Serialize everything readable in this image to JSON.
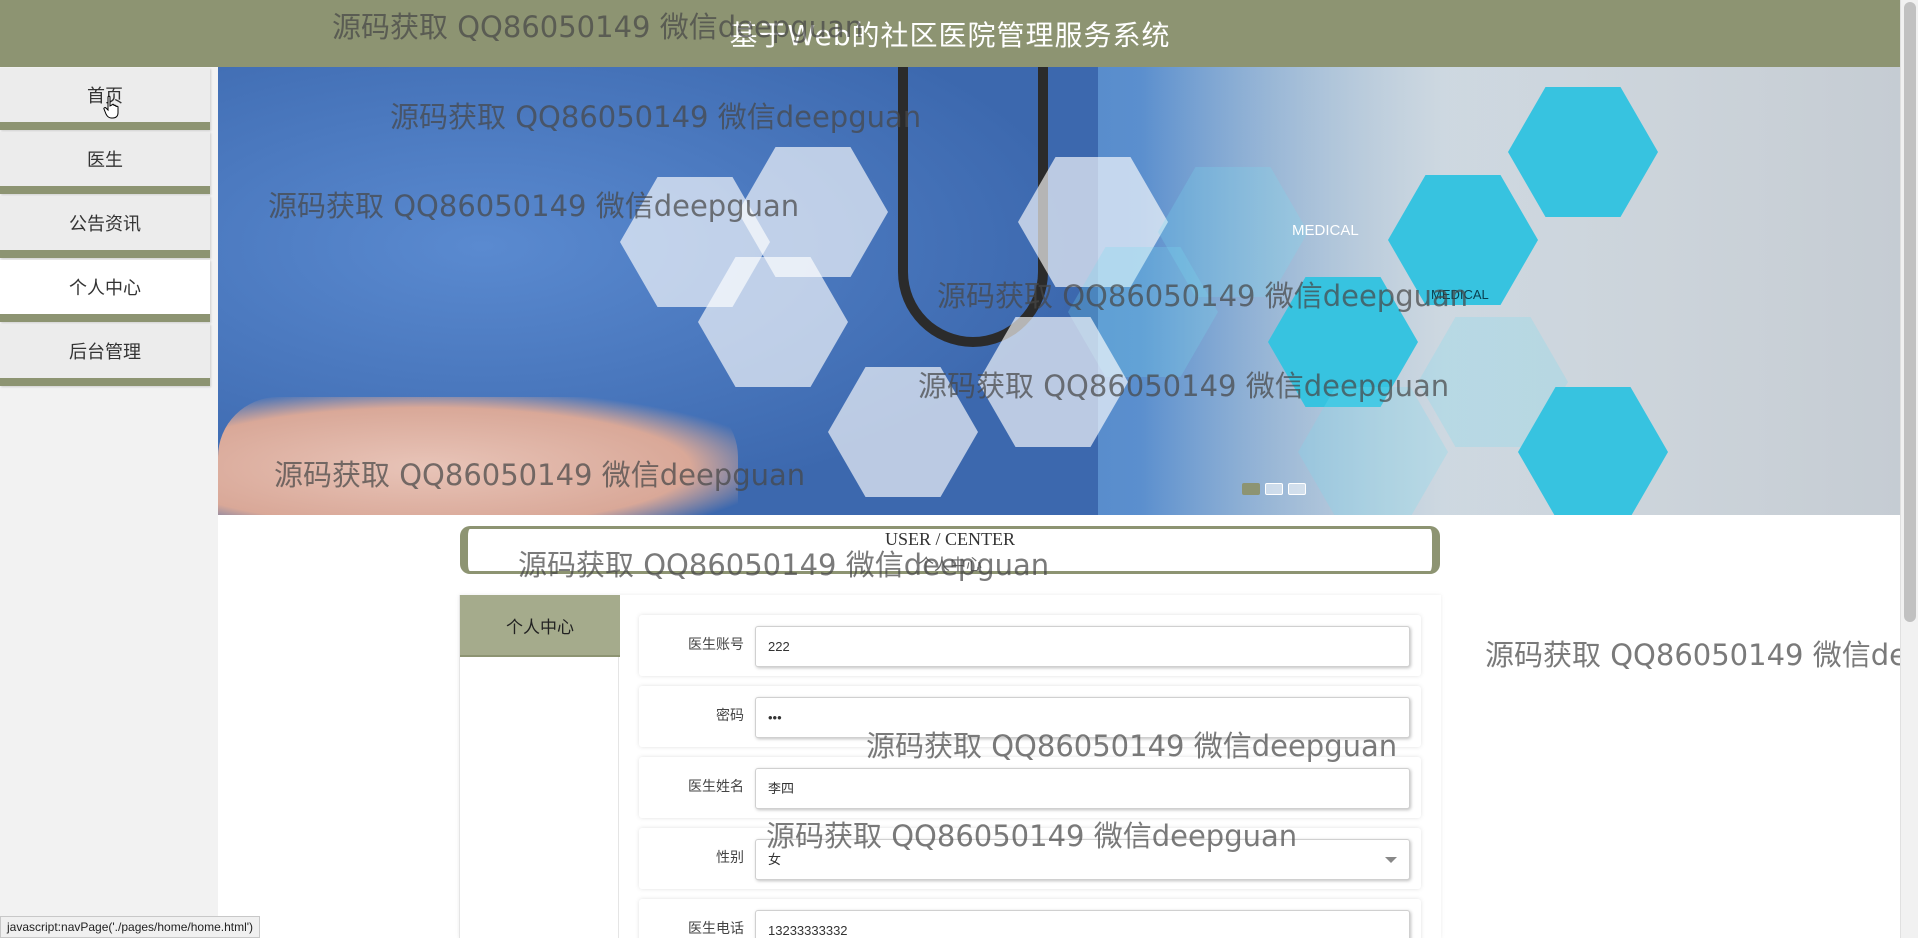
{
  "header": {
    "title": "基于Web的社区医院管理服务系统"
  },
  "sidebar": {
    "items": [
      {
        "label": "首页"
      },
      {
        "label": "医生"
      },
      {
        "label": "公告资讯"
      },
      {
        "label": "个人中心"
      },
      {
        "label": "后台管理"
      }
    ],
    "active_index": 3
  },
  "banner": {
    "hex_labels": [
      "MEDICAL",
      "MEDICAL"
    ],
    "slides": 3,
    "active_slide": 0
  },
  "user_center": {
    "title": "USER / CENTER",
    "subtitle": "个人中心"
  },
  "tabs": [
    {
      "label": "个人中心"
    }
  ],
  "form": {
    "fields": [
      {
        "label": "医生账号",
        "value": "222"
      },
      {
        "label": "密码",
        "value": "•••"
      },
      {
        "label": "医生姓名",
        "value": "李四"
      },
      {
        "label": "性别",
        "value": "女"
      },
      {
        "label": "医生电话",
        "value": "13233333332"
      }
    ]
  },
  "watermark": {
    "text": "源码获取 QQ86050149 微信deepguan"
  },
  "statusbar": {
    "text": "javascript:navPage('./pages/home/home.html')"
  },
  "colors": {
    "accent": "#8d9472",
    "tab_active": "#a5ab8c"
  }
}
